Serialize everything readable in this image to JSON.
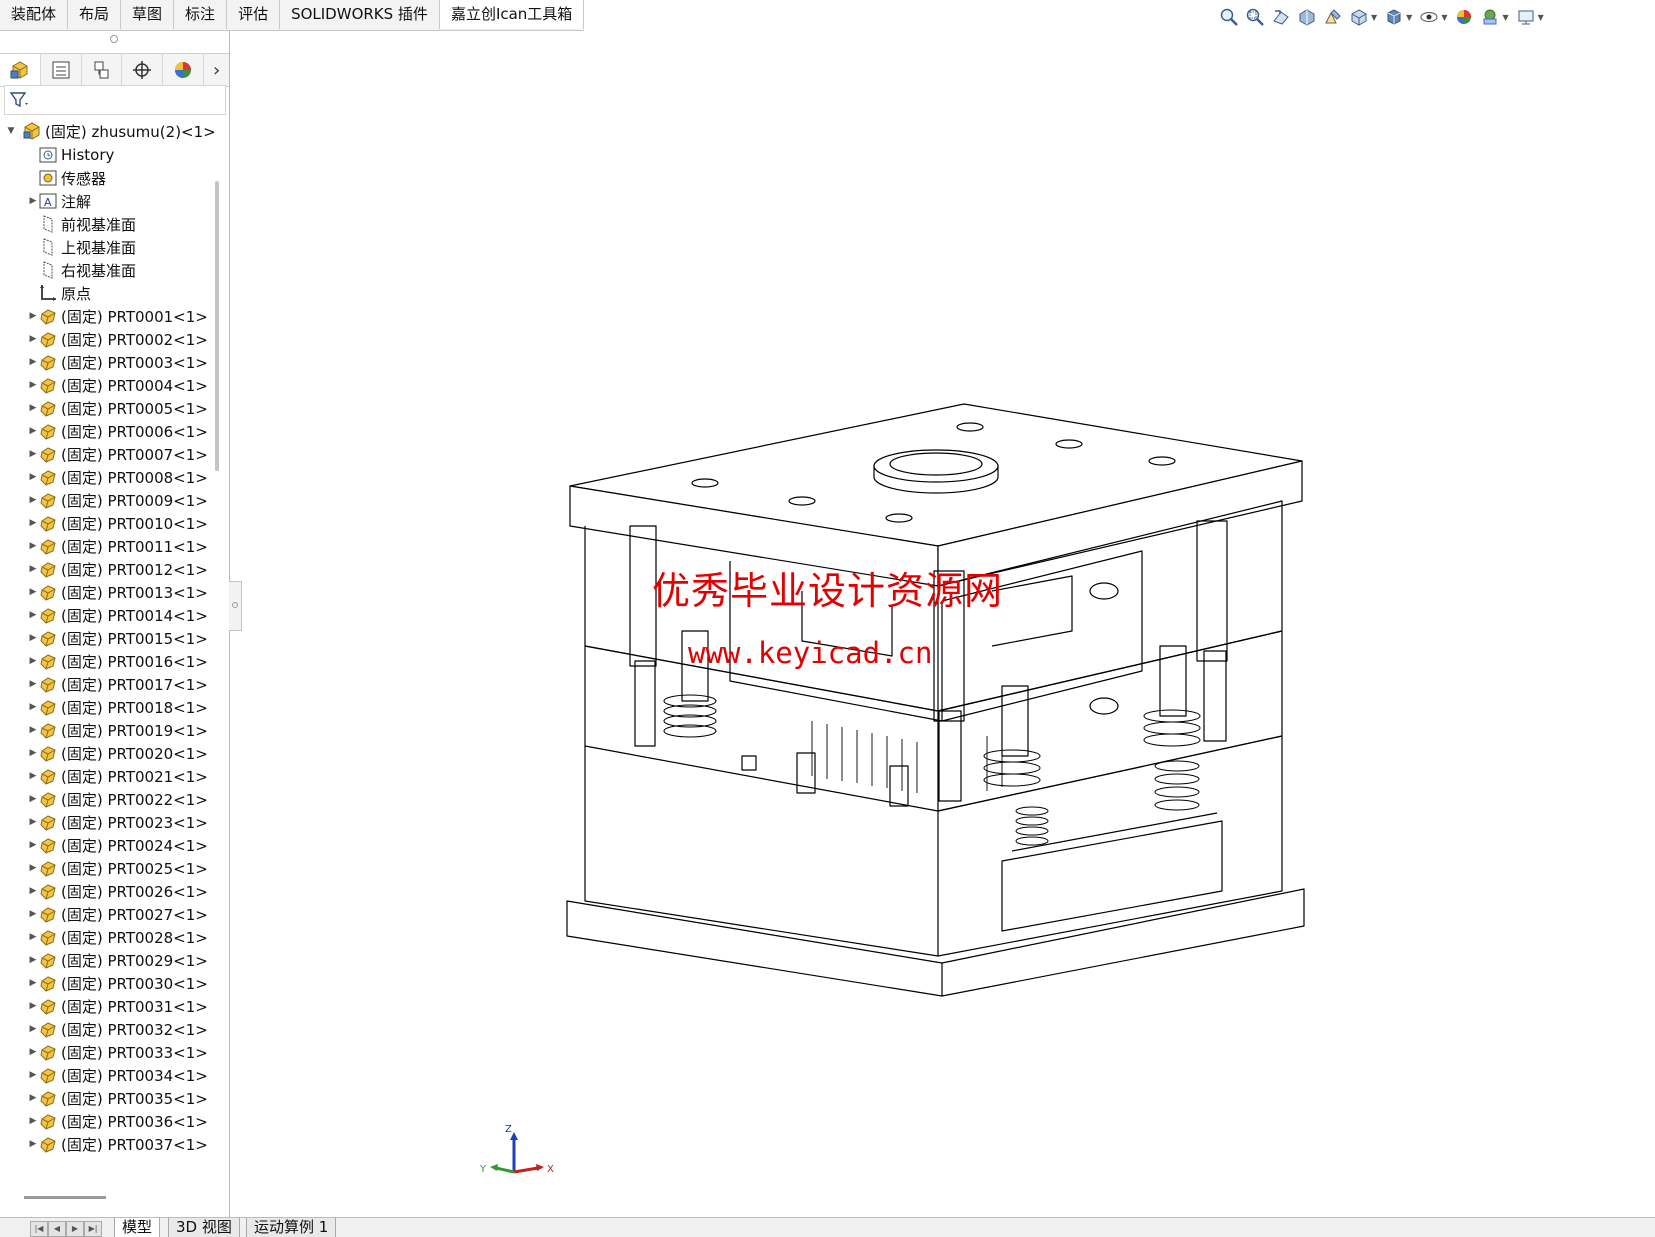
{
  "ribbon_tabs": [
    {
      "label": "装配体",
      "active": false
    },
    {
      "label": "布局",
      "active": false
    },
    {
      "label": "草图",
      "active": false
    },
    {
      "label": "标注",
      "active": false
    },
    {
      "label": "评估",
      "active": false
    },
    {
      "label": "SOLIDWORKS 插件",
      "active": false
    },
    {
      "label": "嘉立创Ican工具箱",
      "active": true
    }
  ],
  "view_toolbar": [
    "zoom-to-fit-icon",
    "zoom-to-area-icon",
    "previous-view-icon",
    "section-view-icon",
    "dynamic-annotation-icon",
    "view-orientation-icon",
    "display-style-icon",
    "hide-show-icon",
    "edit-appearance-icon",
    "apply-scene-icon",
    "view-settings-icon"
  ],
  "feature_manager": {
    "panel_tabs": [
      "featuremanager-tab",
      "propertymanager-tab",
      "configurationmanager-tab",
      "dimxpert-tab",
      "display-manager-tab"
    ],
    "filter_icon": "filter-icon",
    "root": {
      "label": "(固定) zhusumu(2)<1>"
    },
    "fixed_items": [
      {
        "label": "History",
        "icon": "history-icon",
        "expandable": false
      },
      {
        "label": "传感器",
        "icon": "sensor-icon",
        "expandable": false
      },
      {
        "label": "注解",
        "icon": "annotation-icon",
        "expandable": true
      },
      {
        "label": "前视基准面",
        "icon": "plane-icon",
        "expandable": false
      },
      {
        "label": "上视基准面",
        "icon": "plane-icon",
        "expandable": false
      },
      {
        "label": "右视基准面",
        "icon": "plane-icon",
        "expandable": false
      },
      {
        "label": "原点",
        "icon": "origin-icon",
        "expandable": false
      }
    ],
    "parts": [
      "(固定) PRT0001<1>",
      "(固定) PRT0002<1>",
      "(固定) PRT0003<1>",
      "(固定) PRT0004<1>",
      "(固定) PRT0005<1>",
      "(固定) PRT0006<1>",
      "(固定) PRT0007<1>",
      "(固定) PRT0008<1>",
      "(固定) PRT0009<1>",
      "(固定) PRT0010<1>",
      "(固定) PRT0011<1>",
      "(固定) PRT0012<1>",
      "(固定) PRT0013<1>",
      "(固定) PRT0014<1>",
      "(固定) PRT0015<1>",
      "(固定) PRT0016<1>",
      "(固定) PRT0017<1>",
      "(固定) PRT0018<1>",
      "(固定) PRT0019<1>",
      "(固定) PRT0020<1>",
      "(固定) PRT0021<1>",
      "(固定) PRT0022<1>",
      "(固定) PRT0023<1>",
      "(固定) PRT0024<1>",
      "(固定) PRT0025<1>",
      "(固定) PRT0026<1>",
      "(固定) PRT0027<1>",
      "(固定) PRT0028<1>",
      "(固定) PRT0029<1>",
      "(固定) PRT0030<1>",
      "(固定) PRT0031<1>",
      "(固定) PRT0032<1>",
      "(固定) PRT0033<1>",
      "(固定) PRT0034<1>",
      "(固定) PRT0035<1>",
      "(固定) PRT0036<1>",
      "(固定) PRT0037<1>"
    ]
  },
  "watermark": {
    "line1": "优秀毕业设计资源网",
    "line2": "www.keyicad.cn",
    "color": "#e20000"
  },
  "triad": {
    "x": "X",
    "y": "Y",
    "z": "Z"
  },
  "bottom_tabs": [
    {
      "label": "模型",
      "active": true
    },
    {
      "label": "3D 视图",
      "active": false
    },
    {
      "label": "运动算例 1",
      "active": false
    }
  ]
}
